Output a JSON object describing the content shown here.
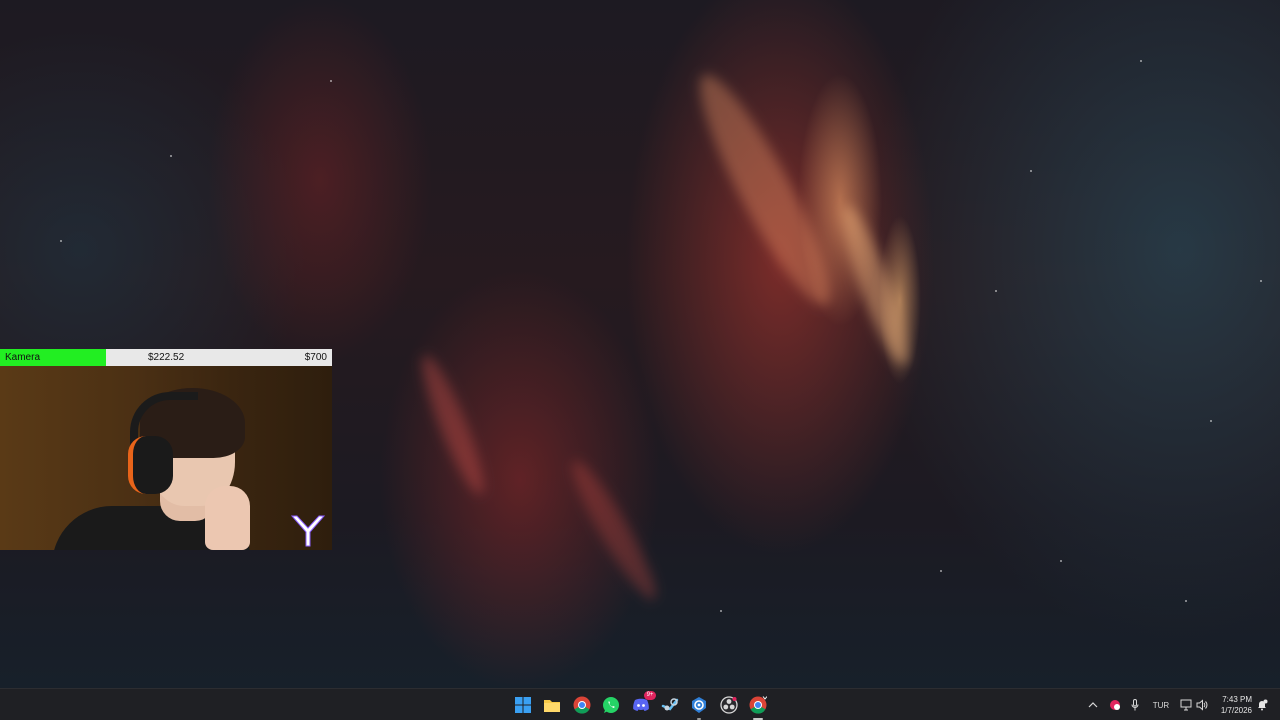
{
  "camera_overlay": {
    "label": "Kamera",
    "current_amount": "$222.52",
    "goal_amount": "$700",
    "progress": 0.3179,
    "progress_color": "#22ee22",
    "logo_icon": "y-logo-icon"
  },
  "taskbar": {
    "pinned": [
      {
        "name": "start-button",
        "icon": "windows-logo-icon"
      },
      {
        "name": "file-explorer",
        "icon": "folder-icon"
      },
      {
        "name": "google-chrome",
        "icon": "chrome-icon"
      },
      {
        "name": "whatsapp",
        "icon": "whatsapp-icon"
      },
      {
        "name": "discord",
        "icon": "discord-icon",
        "badge": "9+"
      },
      {
        "name": "steam",
        "icon": "steam-icon"
      },
      {
        "name": "app-blue",
        "icon": "gear-shield-icon"
      },
      {
        "name": "obs",
        "icon": "obs-icon"
      },
      {
        "name": "chrome-profile",
        "icon": "chrome-icon"
      }
    ],
    "tray": {
      "language": "TUR",
      "time": "7:43 PM",
      "date": "1/7/2026"
    }
  },
  "colors": {
    "taskbar_bg": "#1f2024",
    "badge": "#e0245e"
  }
}
